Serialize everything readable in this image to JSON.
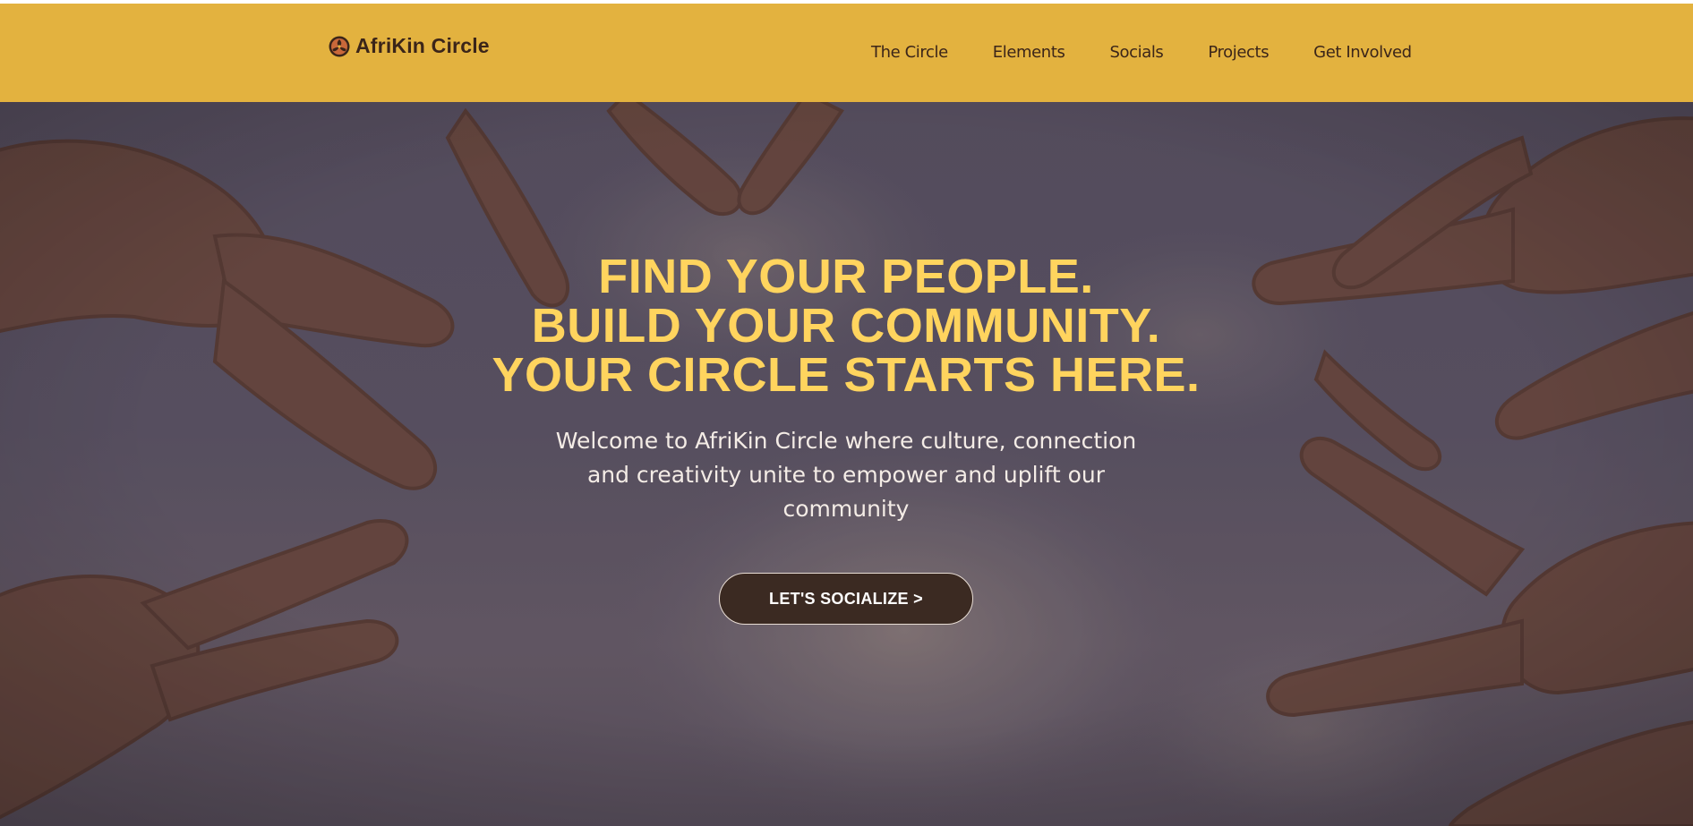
{
  "header": {
    "logo_text": "AfriKin Circle",
    "logo_icon": "afrikin-emblem-icon",
    "nav": [
      {
        "label": "The Circle"
      },
      {
        "label": "Elements"
      },
      {
        "label": "Socials"
      },
      {
        "label": "Projects"
      },
      {
        "label": "Get Involved"
      }
    ]
  },
  "hero": {
    "headline": [
      "FIND YOUR PEOPLE.",
      "BUILD YOUR COMMUNITY.",
      "YOUR CIRCLE STARTS HERE."
    ],
    "subtitle": "Welcome to AfriKin Circle where culture, connection and creativity unite to empower and uplift our community",
    "cta_label": "LET'S SOCIALIZE >"
  },
  "colors": {
    "header_bg": "#e3b23f",
    "headline": "#ffd45e",
    "cta_bg": "#3b2a22",
    "text_dark": "#3b2519"
  }
}
